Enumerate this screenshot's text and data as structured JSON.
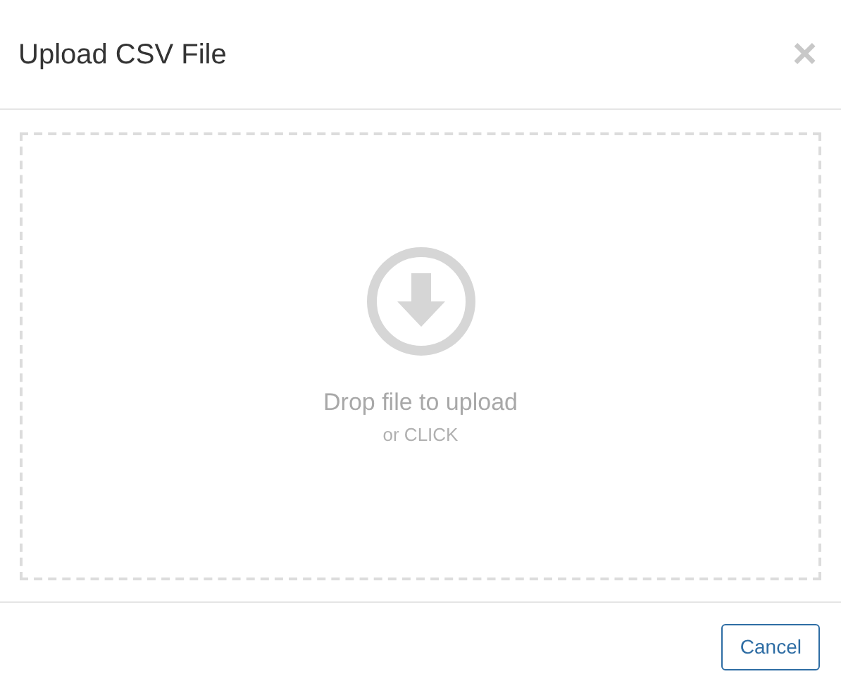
{
  "dialog": {
    "title": "Upload CSV File",
    "close": "×"
  },
  "dropzone": {
    "heading": "Drop file to upload",
    "hint": "or CLICK"
  },
  "buttons": [
    {
      "label": "Cancel"
    }
  ]
}
